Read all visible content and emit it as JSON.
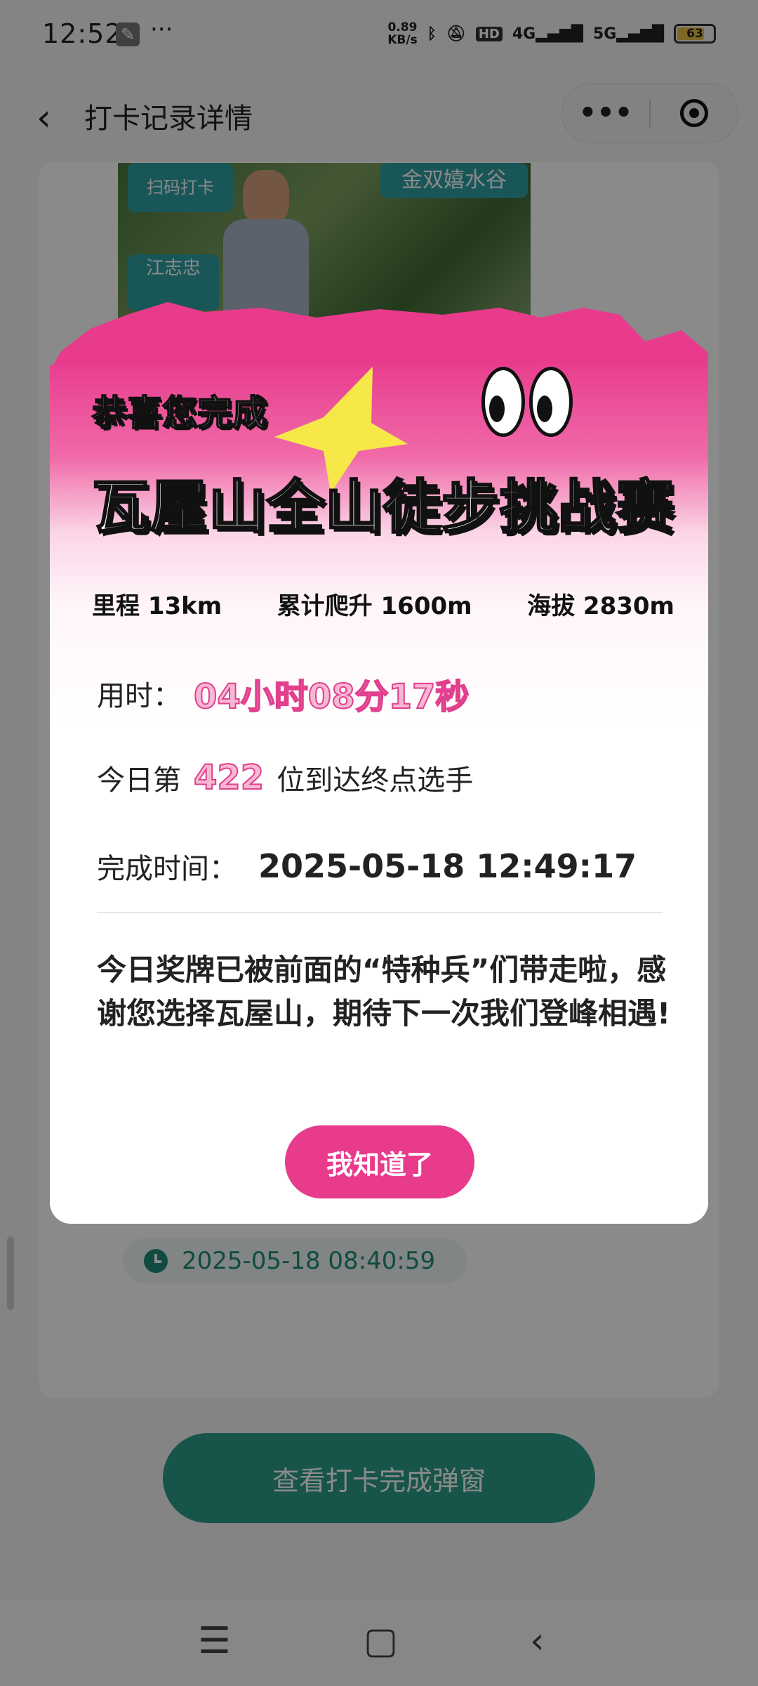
{
  "status_bar": {
    "time": "12:52",
    "net_speed": "0.89\nKB/s",
    "hd": "HD",
    "net_4g": "4G",
    "net_5g": "5G",
    "battery": "63"
  },
  "nav": {
    "title": "打卡记录详情"
  },
  "background": {
    "photo_sign_scan": "扫码打卡",
    "photo_sign_place": "金双嬉水谷",
    "photo_sign_name": "江志忠",
    "checkin_time": "2025-05-18 08:40:59",
    "main_button": "查看打卡完成弹窗"
  },
  "modal": {
    "congrats": "恭喜您完成",
    "event_name": "瓦屋山全山徒步挑战赛",
    "stats": {
      "distance": "里程 13km",
      "climb": "累计爬升 1600m",
      "altitude": "海拔 2830m"
    },
    "duration_label": "用时：",
    "duration_value": "04小时08分17秒",
    "rank_prefix": "今日第",
    "rank_value": "422",
    "rank_suffix": "位到达终点选手",
    "finish_label": "完成时间：",
    "finish_value": "2025-05-18 12:49:17",
    "message": "今日奖牌已被前面的“特种兵”们带走啦，感谢您选择瓦屋山，期待下一次我们登峰相遇!",
    "ok_button": "我知道了"
  },
  "colors": {
    "modal_pink": "#e83b8c",
    "star_yellow": "#f7e84a",
    "primary_green": "#2c9c88"
  }
}
